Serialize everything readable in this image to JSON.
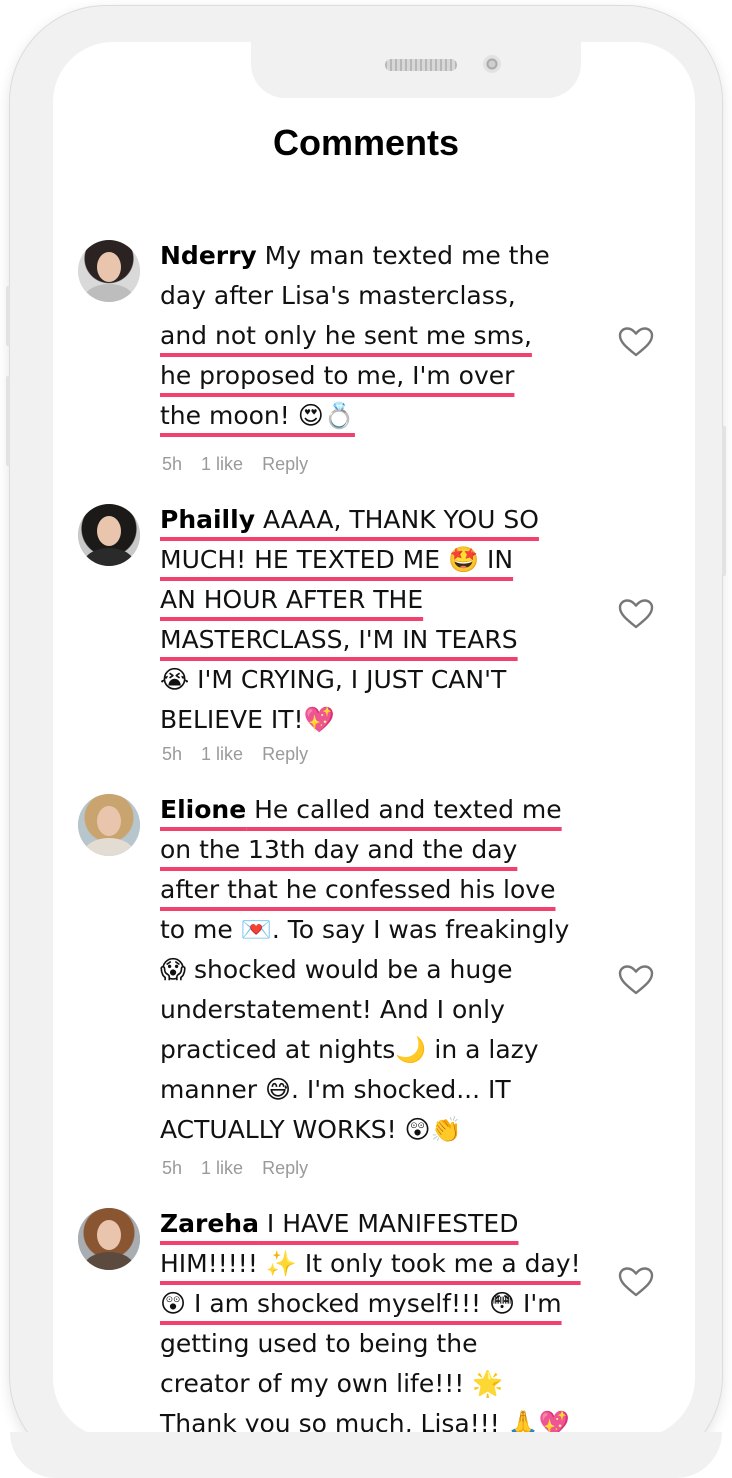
{
  "header": {
    "title": "Comments"
  },
  "comments": [
    {
      "username": "Nderry",
      "lines": [
        " My man texted me the",
        "day after Lisa's masterclass,",
        "and not only he sent me sms,",
        "he proposed to me, I'm over",
        "the moon! 😍💍"
      ],
      "meta": {
        "time": "5h",
        "likes": "1 like",
        "reply": "Reply"
      }
    },
    {
      "username": "Phailly",
      "lines": [
        " AAAA, THANK YOU SO",
        "MUCH! HE TEXTED ME 🤩 IN",
        "AN HOUR AFTER THE",
        "MASTERCLASS, I'M IN TEARS",
        "😭 I'M CRYING, I JUST CAN'T",
        "BELIEVE IT!💖"
      ],
      "meta": {
        "time": "5h",
        "likes": "1 like",
        "reply": "Reply"
      }
    },
    {
      "username": "Elione",
      "lines": [
        " He called and texted me",
        "on the 13th day and the day",
        "after that he confessed his love",
        "to me 💌. To say I was freakingly",
        "😱 shocked would be a huge",
        "understatement! And I only",
        "practiced at nights🌙 in a lazy",
        "manner 😅. I'm shocked... IT",
        "ACTUALLY WORKS! 😲👏"
      ],
      "meta": {
        "time": "5h",
        "likes": "1 like",
        "reply": "Reply"
      }
    },
    {
      "username": "Zareha",
      "lines": [
        " I HAVE MANIFESTED",
        "HIM!!!!! ✨ It only took me a day!",
        "😲 I am shocked myself!!! 😳 I'm",
        "getting used to being the",
        "creator of my own life!!! 🌟",
        "Thank you so much, Lisa!!! 🙏💖"
      ]
    }
  ],
  "colors": {
    "accent_underline": "#f2406f",
    "meta_text": "#9a9a9a"
  },
  "icons": {
    "like": "heart-outline-icon"
  }
}
